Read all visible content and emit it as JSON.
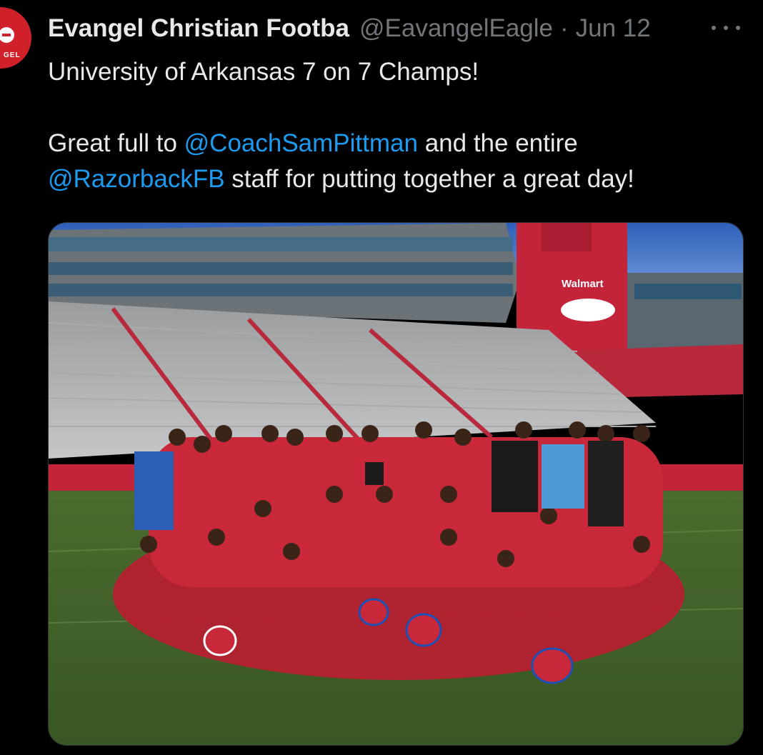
{
  "tweet": {
    "author": {
      "avatar_text": "GEL",
      "display_name": "Evangel Christian Footba",
      "handle": "@EavangelEagle",
      "separator": "·",
      "date": "Jun 12"
    },
    "more_icon": "more-horizontal-icon",
    "body": {
      "line1": "University of Arkansas 7 on 7 Champs!",
      "line2_prefix": "Great full to ",
      "mention1": "@CoachSamPittman",
      "line2_suffix": " and the entire",
      "mention2": "@RazorbackFB",
      "line3_suffix": " staff for putting together a great day!"
    },
    "media": {
      "billboard_text": "Walmart"
    },
    "colors": {
      "background": "#000000",
      "text": "#e7e9ea",
      "secondary": "#71767b",
      "link": "#1d9bf0",
      "avatar_red": "#d0202a"
    }
  }
}
